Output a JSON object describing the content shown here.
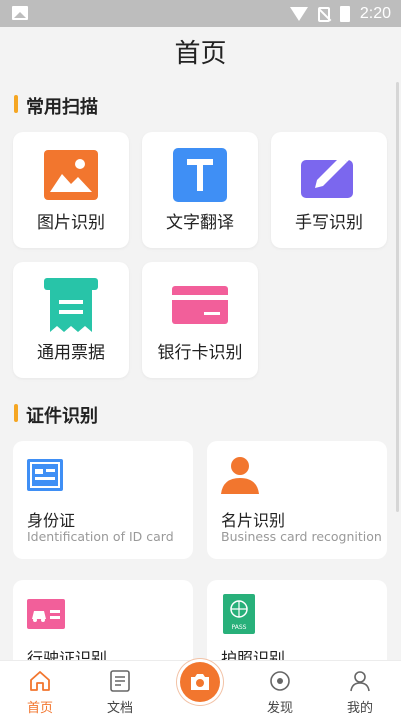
{
  "status": {
    "time": "2:20"
  },
  "header": {
    "title": "首页"
  },
  "sections": {
    "common": {
      "title": "常用扫描"
    },
    "certs": {
      "title": "证件识别"
    }
  },
  "tiles": [
    {
      "label": "图片识别",
      "icon": "image-icon",
      "color": "#f2762e"
    },
    {
      "label": "文字翻译",
      "icon": "text-t-icon",
      "color": "#3f8ff5"
    },
    {
      "label": "手写识别",
      "icon": "pen-icon",
      "color": "#7b67ee"
    },
    {
      "label": "通用票据",
      "icon": "receipt-icon",
      "color": "#28c4a8"
    },
    {
      "label": "银行卡识别",
      "icon": "bank-card-icon",
      "color": "#f25f9a"
    }
  ],
  "cards": [
    {
      "title": "身份证",
      "subtitle": "Identification of ID card",
      "icon": "id-card-icon",
      "color": "#3f8ff5"
    },
    {
      "title": "名片识别",
      "subtitle": "Business card recognition",
      "icon": "person-icon",
      "color": "#f2762e"
    },
    {
      "title": "行驶证识别",
      "icon": "car-license-icon",
      "color": "#f25f9a"
    },
    {
      "title": "护照识别",
      "icon": "passport-icon",
      "color": "#28b07a",
      "badge": "PASS"
    }
  ],
  "tabbar": [
    {
      "label": "首页",
      "icon": "home-icon",
      "active": true
    },
    {
      "label": "文档",
      "icon": "document-icon"
    },
    {
      "label": "",
      "icon": "camera-icon"
    },
    {
      "label": "发现",
      "icon": "discover-icon"
    },
    {
      "label": "我的",
      "icon": "user-icon"
    }
  ],
  "colors": {
    "accent": "#f2762e",
    "section_bar": "#f5a623"
  }
}
